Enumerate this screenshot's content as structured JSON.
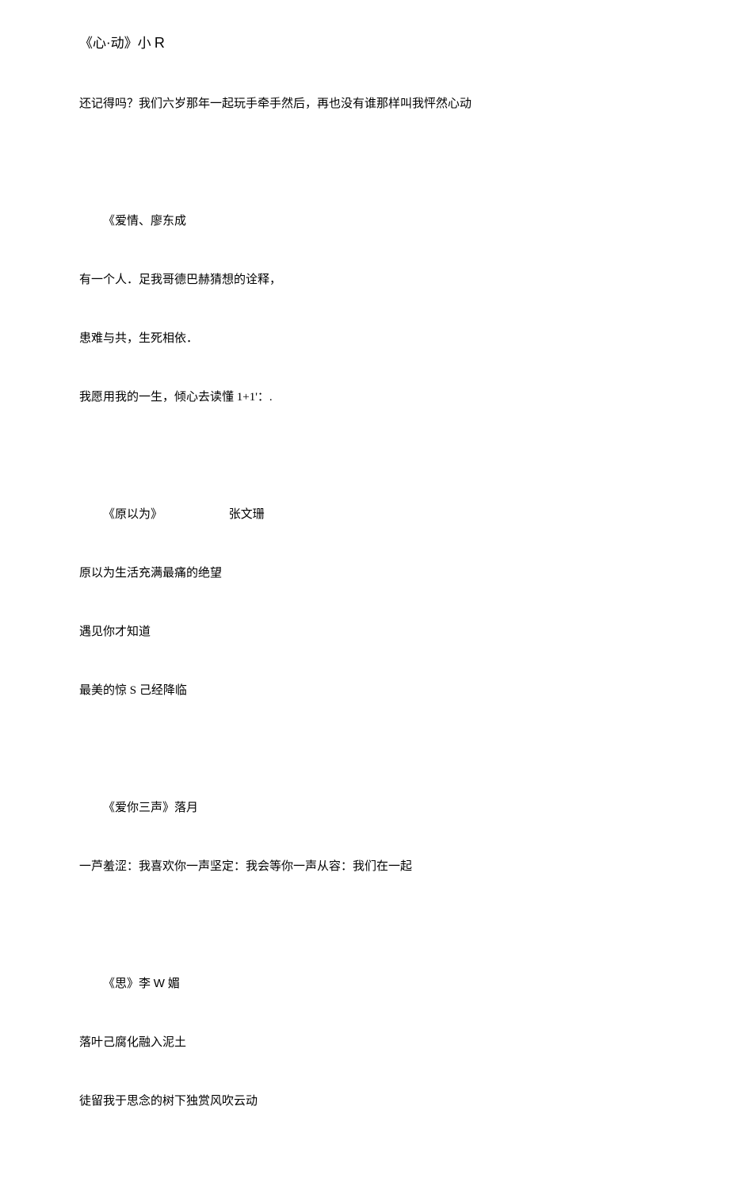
{
  "poems": [
    {
      "title_prefix": "《心·动》小 ",
      "title_letter": "R",
      "lines": [
        "还记得吗？我们六岁那年一起玩手牵手然后，再也没有谁那样叫我怦然心动"
      ]
    },
    {
      "title": "《爱情、廖东成",
      "lines": [
        "有一个人．足我哥德巴赫猜想的诠释，",
        "患难与共，生死相依．",
        "我愿用我的一生，倾心去读懂 1+1'：."
      ]
    },
    {
      "title": "《原以为》",
      "author": "张文珊",
      "lines": [
        "原以为生活充满最痛的绝望",
        "遇见你才知道",
        "最美的惊 S 己经降临"
      ]
    },
    {
      "title": "《爱你三声》落月",
      "lines": [
        "一芦羞涩：我喜欢你一声坚定：我会等你一声从容：我们在一起"
      ]
    },
    {
      "title_prefix": "《思》李 ",
      "title_letter": "W",
      "title_suffix": " 媚",
      "lines": [
        "落叶己腐化融入泥土",
        "徒留我于思念的树下独赏风吹云动"
      ]
    }
  ]
}
